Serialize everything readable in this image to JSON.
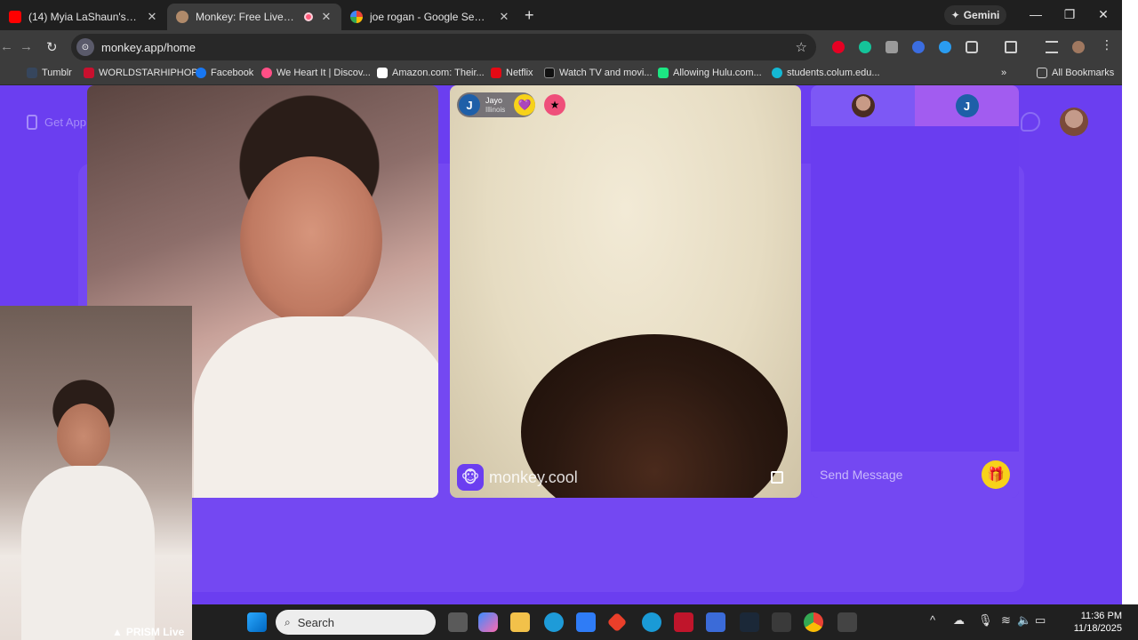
{
  "tabs": [
    {
      "title": "(14) Myia LaShaun's Live broadc",
      "favicon_color": "#ff0000",
      "active": false
    },
    {
      "title": "Monkey: Free Live Video Ch",
      "favicon_color": "#b08a6a",
      "active": true
    },
    {
      "title": "joe rogan - Google Search",
      "favicon_color": "#4285f4",
      "active": false
    }
  ],
  "gemini_label": "Gemini",
  "url": "monkey.app/home",
  "bookmarks": [
    {
      "label": "Tumblr",
      "color": "#36465d"
    },
    {
      "label": "WORLDSTARHIPHOP",
      "color": "#c8102e"
    },
    {
      "label": "Facebook",
      "color": "#1877f2"
    },
    {
      "label": "We Heart It | Discov...",
      "color": "#ff4f86"
    },
    {
      "label": "Amazon.com: Their...",
      "color": "#ffffff"
    },
    {
      "label": "Netflix",
      "color": "#e50914"
    },
    {
      "label": "Watch TV and movi...",
      "color": "#111111"
    },
    {
      "label": "Allowing Hulu.com...",
      "color": "#1ce783"
    },
    {
      "label": "students.colum.edu...",
      "color": "#14b8d4"
    }
  ],
  "all_bookmarks_label": "All Bookmarks",
  "page": {
    "get_app_label": "Get App",
    "accent": "#6b3ef0",
    "partner": {
      "initial": "J",
      "name": "Jayo",
      "location": "Illinois"
    },
    "watermark": "monkey.cool",
    "chat": {
      "placeholder": "Send Message",
      "peer_initial": "J"
    }
  },
  "overlay_label": "PRISM Live",
  "taskbar": {
    "search_label": "Search",
    "time": "11:36 PM",
    "date": "11/18/2025"
  }
}
